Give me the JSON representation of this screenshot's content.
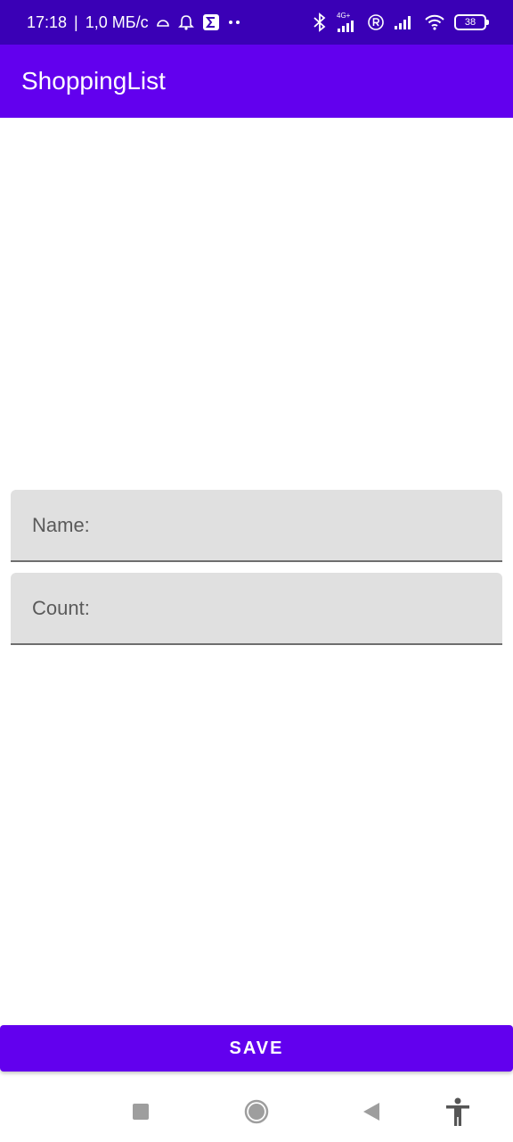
{
  "status_bar": {
    "time": "17:18",
    "separator": "|",
    "speed": "1,0 МБ/с",
    "network_type": "4G+",
    "battery": "38",
    "icons": [
      "cloud-icon",
      "bell-icon",
      "sigma-app-icon",
      "more-dots-icon",
      "bluetooth-icon",
      "signal-icon",
      "roaming-icon",
      "signal-icon",
      "wifi-icon",
      "battery-icon"
    ]
  },
  "app_bar": {
    "title": "ShoppingList"
  },
  "form": {
    "name_label": "Name:",
    "count_label": "Count:"
  },
  "actions": {
    "save_label": "SAVE"
  },
  "nav_bar": {
    "icons": [
      "recent-apps-icon",
      "home-icon",
      "back-icon",
      "accessibility-icon"
    ]
  },
  "colors": {
    "status_bar": "#3a00b6",
    "primary": "#6200ee",
    "field_background": "#e0e0e0"
  }
}
